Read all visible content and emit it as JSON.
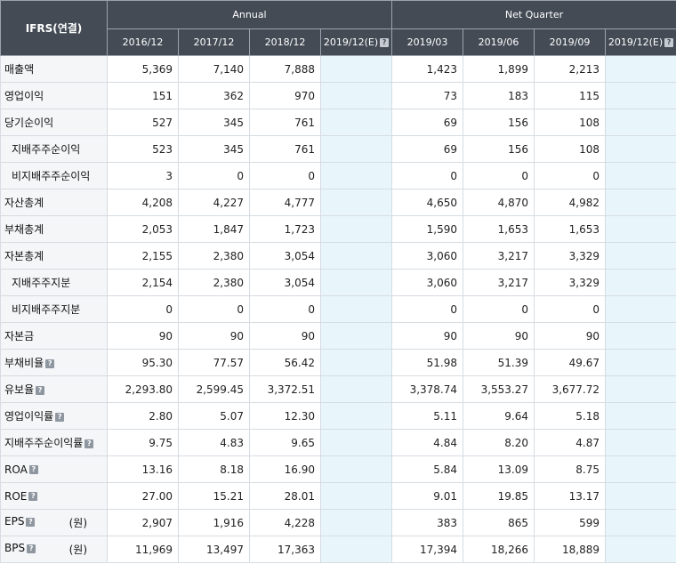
{
  "header": {
    "corner": "IFRS(연결)",
    "annual_label": "Annual",
    "quarter_label": "Net Quarter",
    "periods": [
      "2016/12",
      "2017/12",
      "2018/12",
      "2019/12(E)",
      "2019/03",
      "2019/06",
      "2019/09",
      "2019/12(E)"
    ]
  },
  "rows": [
    {
      "label": "매출액",
      "values": [
        "5,369",
        "7,140",
        "7,888",
        "",
        "1,423",
        "1,899",
        "2,213",
        ""
      ]
    },
    {
      "label": "영업이익",
      "values": [
        "151",
        "362",
        "970",
        "",
        "73",
        "183",
        "115",
        ""
      ]
    },
    {
      "label": "당기순이익",
      "values": [
        "527",
        "345",
        "761",
        "",
        "69",
        "156",
        "108",
        ""
      ]
    },
    {
      "label": "지배주주순이익",
      "values": [
        "523",
        "345",
        "761",
        "",
        "69",
        "156",
        "108",
        ""
      ]
    },
    {
      "label": "비지배주주순이익",
      "values": [
        "3",
        "0",
        "0",
        "",
        "0",
        "0",
        "0",
        ""
      ]
    },
    {
      "label": "자산총계",
      "values": [
        "4,208",
        "4,227",
        "4,777",
        "",
        "4,650",
        "4,870",
        "4,982",
        ""
      ]
    },
    {
      "label": "부채총계",
      "values": [
        "2,053",
        "1,847",
        "1,723",
        "",
        "1,590",
        "1,653",
        "1,653",
        ""
      ]
    },
    {
      "label": "자본총계",
      "values": [
        "2,155",
        "2,380",
        "3,054",
        "",
        "3,060",
        "3,217",
        "3,329",
        ""
      ]
    },
    {
      "label": "지배주주지분",
      "values": [
        "2,154",
        "2,380",
        "3,054",
        "",
        "3,060",
        "3,217",
        "3,329",
        ""
      ]
    },
    {
      "label": "비지배주주지분",
      "values": [
        "0",
        "0",
        "0",
        "",
        "0",
        "0",
        "0",
        ""
      ]
    },
    {
      "label": "자본금",
      "values": [
        "90",
        "90",
        "90",
        "",
        "90",
        "90",
        "90",
        ""
      ]
    },
    {
      "label": "부채비율",
      "values": [
        "95.30",
        "77.57",
        "56.42",
        "",
        "51.98",
        "51.39",
        "49.67",
        ""
      ]
    },
    {
      "label": "유보율",
      "values": [
        "2,293.80",
        "2,599.45",
        "3,372.51",
        "",
        "3,378.74",
        "3,553.27",
        "3,677.72",
        ""
      ]
    },
    {
      "label": "영업이익률",
      "values": [
        "2.80",
        "5.07",
        "12.30",
        "",
        "5.11",
        "9.64",
        "5.18",
        ""
      ]
    },
    {
      "label": "지배주주순이익률",
      "values": [
        "9.75",
        "4.83",
        "9.65",
        "",
        "4.84",
        "8.20",
        "4.87",
        ""
      ]
    },
    {
      "label": "ROA",
      "values": [
        "13.16",
        "8.18",
        "16.90",
        "",
        "5.84",
        "13.09",
        "8.75",
        ""
      ]
    },
    {
      "label": "ROE",
      "values": [
        "27.00",
        "15.21",
        "28.01",
        "",
        "9.01",
        "19.85",
        "13.17",
        ""
      ]
    },
    {
      "label": "EPS",
      "unit": "(원)",
      "values": [
        "2,907",
        "1,916",
        "4,228",
        "",
        "383",
        "865",
        "599",
        ""
      ]
    },
    {
      "label": "BPS",
      "unit": "(원)",
      "values": [
        "11,969",
        "13,497",
        "17,363",
        "",
        "17,394",
        "18,266",
        "18,889",
        ""
      ]
    }
  ],
  "help_icon_glyph": "?"
}
